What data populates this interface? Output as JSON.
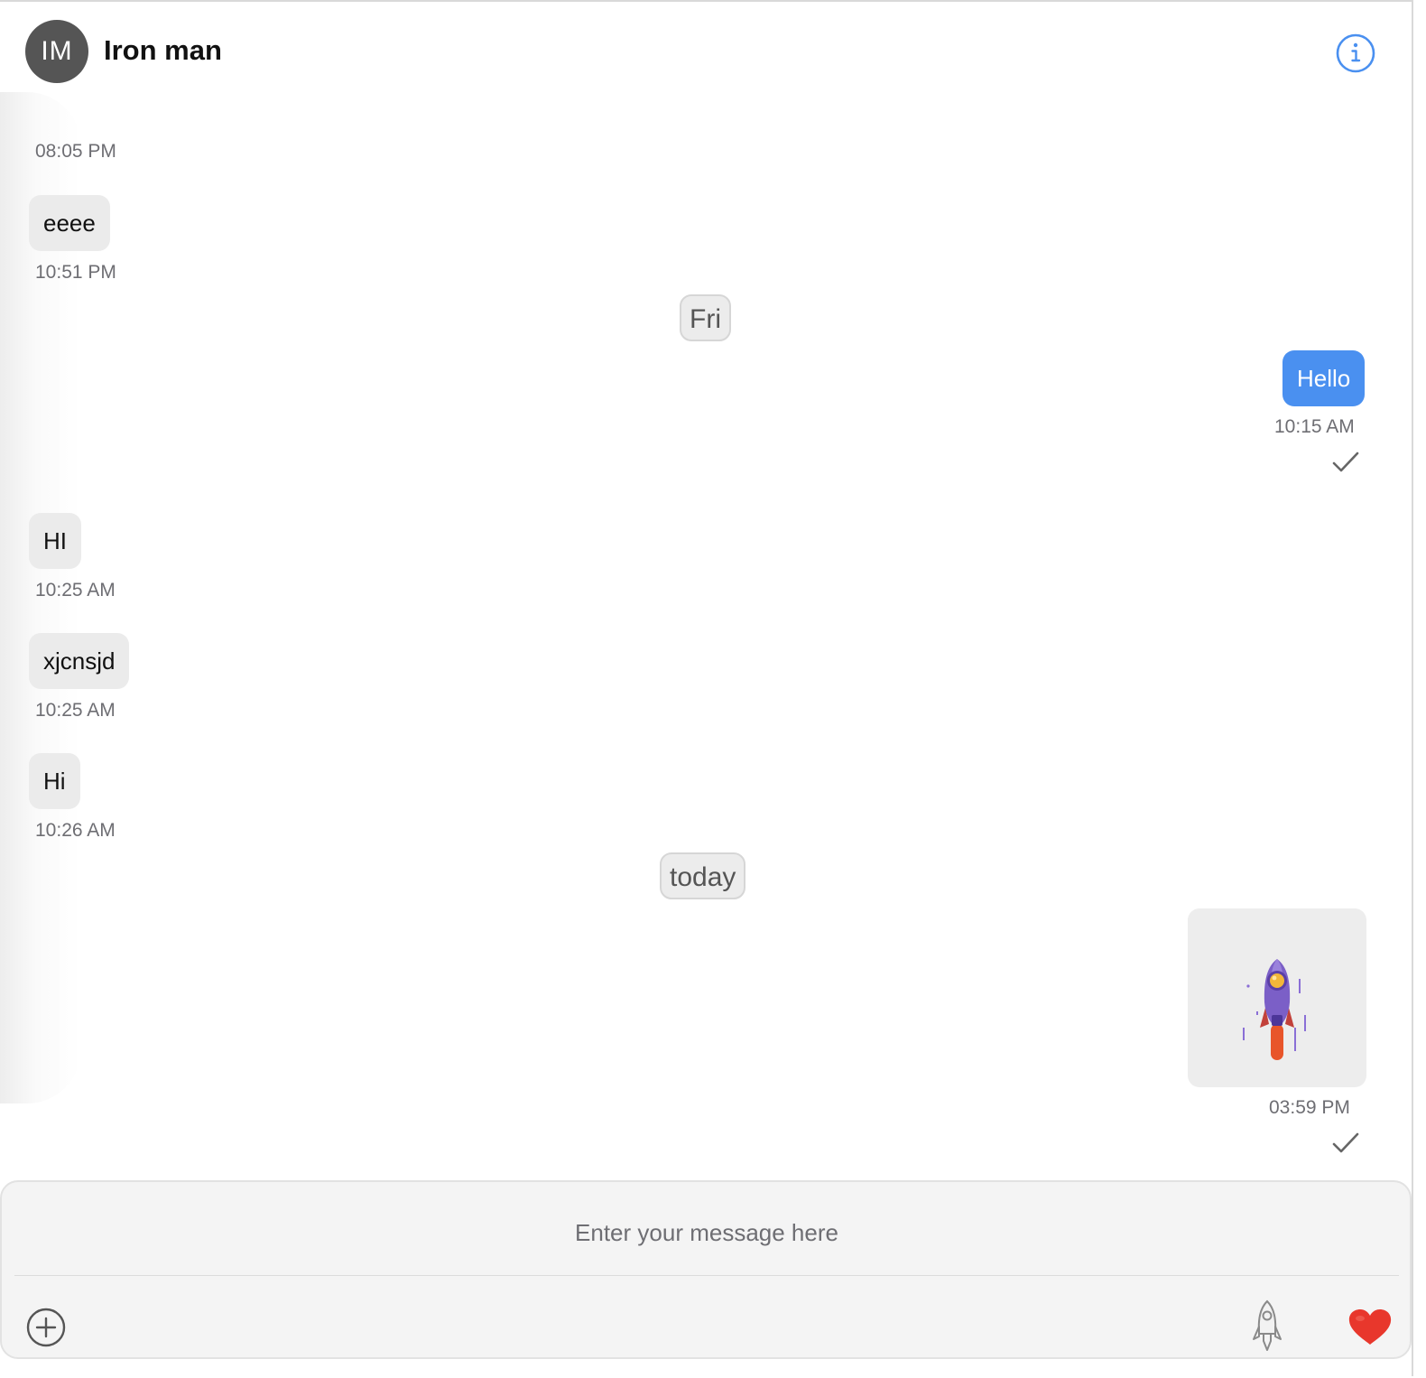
{
  "header": {
    "avatar_initials": "IM",
    "contact_name": "Iron man",
    "info_icon": "info-icon",
    "accent_color": "#4a90f0"
  },
  "messages": {
    "m0_time": "08:05 PM",
    "m1_text": "eeee",
    "m1_time": "10:51 PM",
    "day1": "Fri",
    "m2_text": "Hello",
    "m2_time": "10:15 AM",
    "m3_text": "HI",
    "m3_time": "10:25 AM",
    "m4_text": "xjcnsjd",
    "m4_time": "10:25 AM",
    "m5_text": "Hi",
    "m5_time": "10:26 AM",
    "day2": "today",
    "m6_sticker": "rocket-sticker",
    "m6_time": "03:59 PM"
  },
  "composer": {
    "placeholder": "Enter your message here",
    "add_icon": "plus-circle-icon",
    "sticker_icon": "rocket-icon",
    "like_icon": "heart-icon",
    "heart_color": "#e8372c"
  }
}
